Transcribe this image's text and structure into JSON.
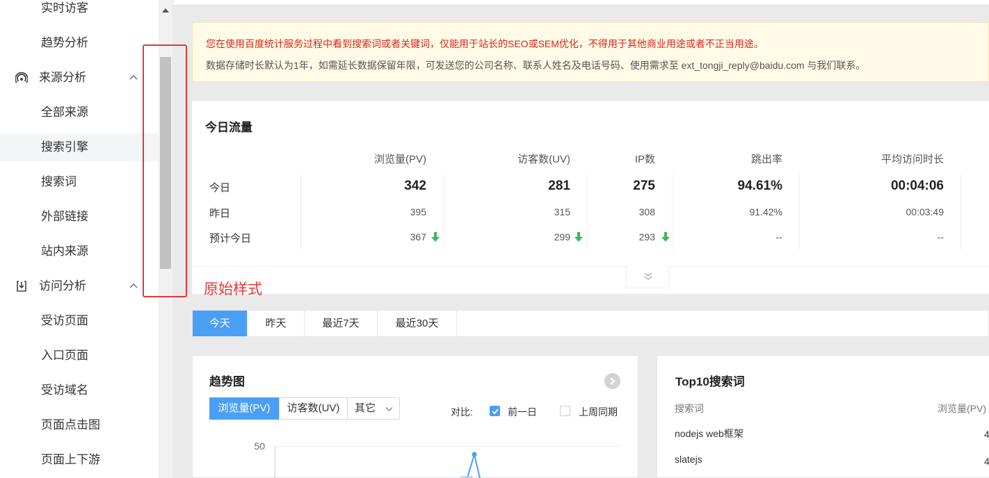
{
  "sidebar": {
    "items": [
      {
        "label": "实时访客",
        "type": "sub",
        "top": -8
      },
      {
        "label": "趋势分析",
        "type": "sub"
      },
      {
        "label": "来源分析",
        "type": "group",
        "icon": "signal-icon"
      },
      {
        "label": "全部来源",
        "type": "sub"
      },
      {
        "label": "搜索引擎",
        "type": "sub",
        "active": true
      },
      {
        "label": "搜索词",
        "type": "sub"
      },
      {
        "label": "外部链接",
        "type": "sub"
      },
      {
        "label": "站内来源",
        "type": "sub"
      },
      {
        "label": "访问分析",
        "type": "group",
        "icon": "download-icon"
      },
      {
        "label": "受访页面",
        "type": "sub"
      },
      {
        "label": "入口页面",
        "type": "sub"
      },
      {
        "label": "受访域名",
        "type": "sub"
      },
      {
        "label": "页面点击图",
        "type": "sub"
      },
      {
        "label": "页面上下游",
        "type": "sub"
      }
    ]
  },
  "notice": {
    "line1": "您在使用百度统计服务过程中看到搜索词或者关键词，仅能用于站长的SEO或SEM优化，不得用于其他商业用途或者不正当用途。",
    "line2": "数据存储时长默认为1年，如需延长数据保留年限，可发送您的公司名称、联系人姓名及电话号码、使用需求至 ext_tongji_reply@baidu.com 与我们联系。"
  },
  "traffic": {
    "title": "今日流量",
    "columns": [
      "浏览量(PV)",
      "访客数(UV)",
      "IP数",
      "跳出率",
      "平均访问时长"
    ],
    "rows": [
      {
        "label": "今日",
        "values": [
          "342",
          "281",
          "275",
          "94.61%",
          "00:04:06"
        ]
      },
      {
        "label": "昨日",
        "values": [
          "395",
          "315",
          "308",
          "91.42%",
          "00:03:49"
        ]
      },
      {
        "label": "预计今日",
        "values": [
          "367",
          "299",
          "293",
          "--",
          "--"
        ]
      }
    ],
    "annotation": "原始样式"
  },
  "range_tabs": [
    "今天",
    "昨天",
    "最近7天",
    "最近30天"
  ],
  "trend": {
    "title": "趋势图",
    "metric_tabs": [
      "浏览量(PV)",
      "访客数(UV)",
      "其它"
    ],
    "compare_label": "对比:",
    "compare_options": [
      {
        "label": "前一日",
        "checked": true
      },
      {
        "label": "上周同期",
        "checked": false
      }
    ]
  },
  "chart_data": {
    "type": "line",
    "yticks": [
      "50"
    ],
    "ylim": [
      0,
      50
    ],
    "series": [
      {
        "values": [
          46,
          10
        ]
      }
    ]
  },
  "top10": {
    "title": "Top10搜索词",
    "col_word": "搜索词",
    "col_pv": "浏览量(PV)",
    "rows": [
      {
        "word": "nodejs web框架",
        "pv": "4"
      },
      {
        "word": "slatejs",
        "pv": "4"
      }
    ]
  },
  "colors": {
    "accent": "#4a9ff5",
    "warning_text": "#d9251d",
    "highlight": "#e53935",
    "down_arrow": "#3cb95d"
  }
}
